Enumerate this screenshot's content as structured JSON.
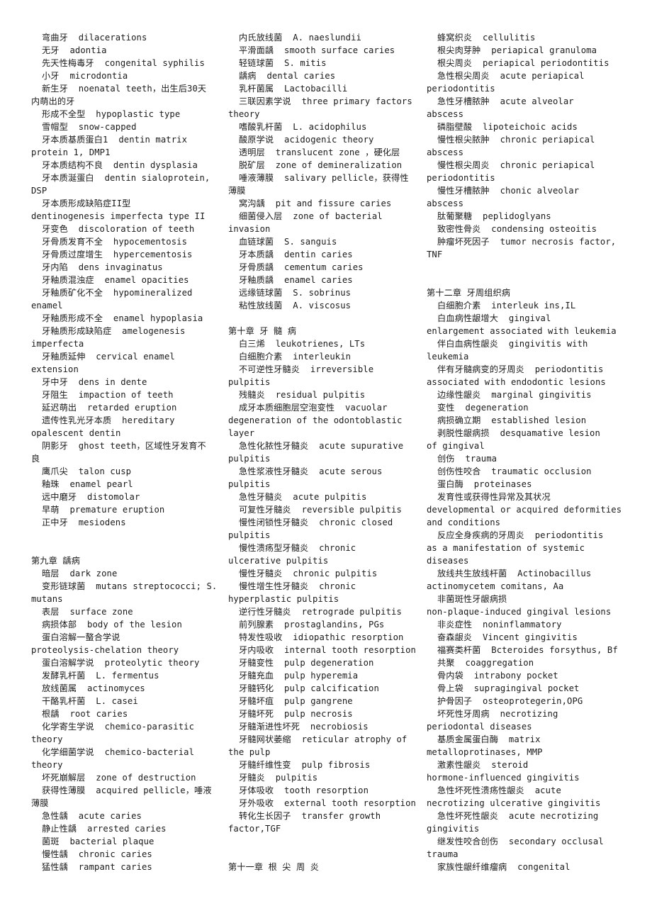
{
  "columns": [
    {
      "lines": [
        {
          "t": "entry",
          "v": "弯曲牙  dilacerations"
        },
        {
          "t": "entry",
          "v": "无牙  adontia"
        },
        {
          "t": "entry",
          "v": "先天性梅毒牙  congenital syphilis"
        },
        {
          "t": "entry",
          "v": "小牙  microdontia"
        },
        {
          "t": "entry",
          "v": "新生牙  noenatal teeth，出生后30天"
        },
        {
          "t": "cont",
          "v": "内萌出的牙"
        },
        {
          "t": "entry",
          "v": "形成不全型  hypoplastic type"
        },
        {
          "t": "entry",
          "v": "雪帽型  snow-capped"
        },
        {
          "t": "entry",
          "v": "牙本质基质蛋白1  dentin matrix"
        },
        {
          "t": "cont",
          "v": "protein 1, DMP1"
        },
        {
          "t": "entry",
          "v": "牙本质结构不良  dentin dysplasia"
        },
        {
          "t": "entry",
          "v": "牙本质涎蛋白  dentin sialoprotein,"
        },
        {
          "t": "cont",
          "v": "DSP"
        },
        {
          "t": "entry",
          "v": "牙本质形成缺陷症II型"
        },
        {
          "t": "cont",
          "v": "dentinogenesis imperfecta type II"
        },
        {
          "t": "entry",
          "v": "牙变色  discoloration of teeth"
        },
        {
          "t": "entry",
          "v": "牙骨质发育不全  hypocementosis"
        },
        {
          "t": "entry",
          "v": "牙骨质过度增生  hypercementosis"
        },
        {
          "t": "entry",
          "v": "牙内陷  dens invaginatus"
        },
        {
          "t": "entry",
          "v": "牙釉质混浊症  enamel opacities"
        },
        {
          "t": "entry",
          "v": "牙釉质矿化不全  hypomineralized"
        },
        {
          "t": "cont",
          "v": "enamel"
        },
        {
          "t": "entry",
          "v": "牙釉质形成不全  enamel hypoplasia"
        },
        {
          "t": "entry",
          "v": "牙釉质形成缺陷症  amelogenesis"
        },
        {
          "t": "cont",
          "v": "imperfecta"
        },
        {
          "t": "entry",
          "v": "牙釉质延伸  cervical enamel"
        },
        {
          "t": "cont",
          "v": "extension"
        },
        {
          "t": "entry",
          "v": "牙中牙  dens in dente"
        },
        {
          "t": "entry",
          "v": "牙阻生  impaction of teeth"
        },
        {
          "t": "entry",
          "v": "延迟萌出  retarded eruption"
        },
        {
          "t": "entry",
          "v": "遗传性乳光牙本质  hereditary"
        },
        {
          "t": "cont",
          "v": "opalescent dentin"
        },
        {
          "t": "entry",
          "v": "阴影牙  ghost teeth，区域性牙发育不"
        },
        {
          "t": "cont",
          "v": "良"
        },
        {
          "t": "entry",
          "v": "鹰爪尖  talon cusp"
        },
        {
          "t": "entry",
          "v": "釉珠  enamel pearl"
        },
        {
          "t": "entry",
          "v": "远中磨牙  distomolar"
        },
        {
          "t": "entry",
          "v": "早萌  premature eruption"
        },
        {
          "t": "entry",
          "v": "正中牙  mesiodens"
        },
        {
          "t": "blank",
          "v": ""
        },
        {
          "t": "blank",
          "v": ""
        },
        {
          "t": "heading",
          "v": "第九章 龋病"
        },
        {
          "t": "entry",
          "v": "暗层  dark zone"
        },
        {
          "t": "entry",
          "v": "变形链球菌  mutans streptococci; S."
        },
        {
          "t": "cont",
          "v": "mutans"
        },
        {
          "t": "entry",
          "v": "表层  surface zone"
        },
        {
          "t": "entry",
          "v": "病损体部  body of the lesion"
        },
        {
          "t": "entry",
          "v": "蛋白溶解一螯合学说"
        },
        {
          "t": "cont",
          "v": "proteolysis-chelation theory"
        },
        {
          "t": "entry",
          "v": "蛋白溶解学说  proteolytic theory"
        },
        {
          "t": "entry",
          "v": "发酵乳杆菌  L. fermentus"
        },
        {
          "t": "entry",
          "v": "放线菌属  actinomyces"
        },
        {
          "t": "entry",
          "v": "干酪乳杆菌  L. casei"
        },
        {
          "t": "entry",
          "v": "根龋  root caries"
        },
        {
          "t": "entry",
          "v": "化学寄生学说  chemico-parasitic"
        },
        {
          "t": "cont",
          "v": "theory"
        },
        {
          "t": "entry",
          "v": "化学细菌学说  chemico-bacterial"
        },
        {
          "t": "cont",
          "v": "theory"
        },
        {
          "t": "entry",
          "v": "坏死崩解层  zone of destruction"
        },
        {
          "t": "entry",
          "v": "获得性薄膜  acquired pellicle，唾液"
        },
        {
          "t": "cont",
          "v": "薄膜"
        },
        {
          "t": "entry",
          "v": "急性龋  acute caries"
        },
        {
          "t": "entry",
          "v": "静止性龋  arrested caries"
        },
        {
          "t": "entry",
          "v": "菌斑  bacterial plaque"
        },
        {
          "t": "entry",
          "v": "慢性龋  chronic caries"
        },
        {
          "t": "entry",
          "v": "猛性龋  rampant caries"
        }
      ]
    },
    {
      "lines": [
        {
          "t": "entry",
          "v": "内氏放线菌  A. naeslundii"
        },
        {
          "t": "entry",
          "v": "平滑面龋  smooth surface caries"
        },
        {
          "t": "entry",
          "v": "轻链球菌  S. mitis"
        },
        {
          "t": "entry",
          "v": "龋病  dental caries"
        },
        {
          "t": "entry",
          "v": "乳杆菌属  Lactobacilli"
        },
        {
          "t": "entry",
          "v": "三联因素学说  three primary factors"
        },
        {
          "t": "cont",
          "v": "theory"
        },
        {
          "t": "entry",
          "v": "嗜酸乳杆菌  L. acidophilus"
        },
        {
          "t": "entry",
          "v": "酸原学说  acidogenic theory"
        },
        {
          "t": "entry",
          "v": "透明层  translucent zone ，硬化层"
        },
        {
          "t": "entry",
          "v": "脱矿层  zone of demineralization"
        },
        {
          "t": "entry",
          "v": "唾液薄膜  salivary pellicle，获得性"
        },
        {
          "t": "cont",
          "v": "薄膜"
        },
        {
          "t": "entry",
          "v": "窝沟龋  pit and fissure caries"
        },
        {
          "t": "entry",
          "v": "细菌侵入层  zone of bacterial"
        },
        {
          "t": "cont",
          "v": "invasion"
        },
        {
          "t": "entry",
          "v": "血链球菌  S. sanguis"
        },
        {
          "t": "entry",
          "v": "牙本质龋  dentin caries"
        },
        {
          "t": "entry",
          "v": "牙骨质龋  cementum caries"
        },
        {
          "t": "entry",
          "v": "牙釉质龋  enamel caries"
        },
        {
          "t": "entry",
          "v": "远缘链球菌  S. sobrinus"
        },
        {
          "t": "entry",
          "v": "粘性放线菌  A. viscosus"
        },
        {
          "t": "blank",
          "v": ""
        },
        {
          "t": "heading",
          "v": "第十章 牙 髓 病"
        },
        {
          "t": "entry",
          "v": "白三烯  leukotrienes, LTs"
        },
        {
          "t": "entry",
          "v": "白细胞介素  interleukin"
        },
        {
          "t": "entry",
          "v": "不可逆性牙髓炎  irreversible"
        },
        {
          "t": "cont",
          "v": "pulpitis"
        },
        {
          "t": "entry",
          "v": "残髓炎  residual pulpitis"
        },
        {
          "t": "entry",
          "v": "成牙本质细胞层空泡变性  vacuolar"
        },
        {
          "t": "cont",
          "v": "degeneration of the odontoblastic"
        },
        {
          "t": "cont",
          "v": "layer"
        },
        {
          "t": "entry",
          "v": "急性化脓性牙髓炎  acute supurative"
        },
        {
          "t": "cont",
          "v": "pulpitis"
        },
        {
          "t": "entry",
          "v": "急性浆液性牙髓炎  acute serous"
        },
        {
          "t": "cont",
          "v": "pulpitis"
        },
        {
          "t": "entry",
          "v": "急性牙髓炎  acute pulpitis"
        },
        {
          "t": "entry",
          "v": "可复性牙髓炎  reversible pulpitis"
        },
        {
          "t": "entry",
          "v": "慢性闭锁性牙髓炎  chronic closed"
        },
        {
          "t": "cont",
          "v": "pulpitis"
        },
        {
          "t": "entry",
          "v": "慢性溃疡型牙髓炎  chronic"
        },
        {
          "t": "cont",
          "v": "ulcerative pulpitis"
        },
        {
          "t": "entry",
          "v": "慢性牙髓炎  chronic pulpitis"
        },
        {
          "t": "entry",
          "v": "慢性增生性牙髓炎  chronic"
        },
        {
          "t": "cont",
          "v": "hyperplastic pulpitis"
        },
        {
          "t": "entry",
          "v": "逆行性牙髓炎  retrograde pulpitis"
        },
        {
          "t": "entry",
          "v": "前列腺素  prostaglandins, PGs"
        },
        {
          "t": "entry",
          "v": "特发性吸收  idiopathic resorption"
        },
        {
          "t": "entry",
          "v": "牙内吸收  internal tooth resorption"
        },
        {
          "t": "entry",
          "v": "牙髓变性  pulp degeneration"
        },
        {
          "t": "entry",
          "v": "牙髓充血  pulp hyperemia"
        },
        {
          "t": "entry",
          "v": "牙髓钙化  pulp calcification"
        },
        {
          "t": "entry",
          "v": "牙髓坏疽  pulp gangrene"
        },
        {
          "t": "entry",
          "v": "牙髓坏死  pulp necrosis"
        },
        {
          "t": "entry",
          "v": "牙髓渐进性坏死  necrobiosis"
        },
        {
          "t": "entry",
          "v": "牙髓网状萎缩  reticular atrophy of"
        },
        {
          "t": "cont",
          "v": "the pulp"
        },
        {
          "t": "entry",
          "v": "牙髓纤维性变  pulp fibrosis"
        },
        {
          "t": "entry",
          "v": "牙髓炎  pulpitis"
        },
        {
          "t": "entry",
          "v": "牙体吸收  tooth resorption"
        },
        {
          "t": "entry",
          "v": "牙外吸收  external tooth resorption"
        },
        {
          "t": "entry",
          "v": "转化生长因子  transfer growth"
        },
        {
          "t": "cont",
          "v": "factor,TGF"
        },
        {
          "t": "blank",
          "v": ""
        },
        {
          "t": "blank",
          "v": ""
        },
        {
          "t": "heading",
          "v": "第十一章 根 尖 周 炎"
        }
      ]
    },
    {
      "lines": [
        {
          "t": "entry",
          "v": "蜂窝织炎  cellulitis"
        },
        {
          "t": "entry",
          "v": "根尖肉芽肿  periapical granuloma"
        },
        {
          "t": "entry",
          "v": "根尖周炎  periapical periodontitis"
        },
        {
          "t": "entry",
          "v": "急性根尖周炎  acute periapical"
        },
        {
          "t": "cont",
          "v": "periodontitis"
        },
        {
          "t": "entry",
          "v": "急性牙槽脓肿  acute alveolar"
        },
        {
          "t": "cont",
          "v": "abscess"
        },
        {
          "t": "entry",
          "v": "磷脂壁酸  lipoteichoic acids"
        },
        {
          "t": "entry",
          "v": "慢性根尖脓肿  chronic periapical"
        },
        {
          "t": "cont",
          "v": "abscess"
        },
        {
          "t": "entry",
          "v": "慢性根尖周炎  chronic periapical"
        },
        {
          "t": "cont",
          "v": "periodontitis"
        },
        {
          "t": "entry",
          "v": "慢性牙槽脓肿  chonic alveolar"
        },
        {
          "t": "cont",
          "v": "abscess"
        },
        {
          "t": "entry",
          "v": "肽葡聚糖  peplidoglyans"
        },
        {
          "t": "entry",
          "v": "致密性骨炎  condensing osteoitis"
        },
        {
          "t": "entry",
          "v": "肿瘤坏死因子  tumor necrosis factor,"
        },
        {
          "t": "cont",
          "v": "TNF"
        },
        {
          "t": "blank",
          "v": ""
        },
        {
          "t": "blank",
          "v": ""
        },
        {
          "t": "heading",
          "v": "第十二章 牙周组织病"
        },
        {
          "t": "entry",
          "v": "白细胞介素  interleuk ins,IL"
        },
        {
          "t": "entry",
          "v": "白血病性龈增大  gingival"
        },
        {
          "t": "cont",
          "v": "enlargement associated with leukemia"
        },
        {
          "t": "entry",
          "v": "伴白血病性龈炎  gingivitis with"
        },
        {
          "t": "cont",
          "v": "leukemia"
        },
        {
          "t": "entry",
          "v": "伴有牙髓病变的牙周炎  periodontitis"
        },
        {
          "t": "cont",
          "v": "associated with endodontic lesions"
        },
        {
          "t": "entry",
          "v": "边缘性龈炎  marginal gingivitis"
        },
        {
          "t": "entry",
          "v": "变性  degeneration"
        },
        {
          "t": "entry",
          "v": "病损确立期  established lesion"
        },
        {
          "t": "entry",
          "v": "剥脱性龈病损  desquamative lesion"
        },
        {
          "t": "cont",
          "v": "of gingival"
        },
        {
          "t": "entry",
          "v": "创伤  trauma"
        },
        {
          "t": "entry",
          "v": "创伤性咬合  traumatic occlusion"
        },
        {
          "t": "entry",
          "v": "蛋白酶  proteinases"
        },
        {
          "t": "entry",
          "v": "发育性或获得性异常及其状况"
        },
        {
          "t": "cont",
          "v": "developmental or acquired deformities"
        },
        {
          "t": "cont",
          "v": "and conditions"
        },
        {
          "t": "entry",
          "v": "反应全身疾病的牙周炎  periodontitis"
        },
        {
          "t": "cont",
          "v": "as a manifestation of systemic"
        },
        {
          "t": "cont",
          "v": "diseases"
        },
        {
          "t": "entry",
          "v": "放线共生放线杆菌  Actinobacillus"
        },
        {
          "t": "cont",
          "v": "actinomycetem comitans, Aa"
        },
        {
          "t": "entry",
          "v": "非菌斑性牙龈病损"
        },
        {
          "t": "cont",
          "v": "non-plaque-induced gingival lesions"
        },
        {
          "t": "entry",
          "v": "非炎症性  noninflammatory"
        },
        {
          "t": "entry",
          "v": "奋森龈炎  Vincent gingivitis"
        },
        {
          "t": "entry",
          "v": "福赛类杆菌  Bcteroides forsythus, Bf"
        },
        {
          "t": "entry",
          "v": "共聚  coaggregation"
        },
        {
          "t": "entry",
          "v": "骨内袋  intrabony pocket"
        },
        {
          "t": "entry",
          "v": "骨上袋  supragingival pocket"
        },
        {
          "t": "entry",
          "v": "护骨因子  osteoprotegerin,OPG"
        },
        {
          "t": "entry",
          "v": "坏死性牙周病  necrotizing"
        },
        {
          "t": "cont",
          "v": "periodontal diseases"
        },
        {
          "t": "entry",
          "v": "基质金属蛋白酶  matrix"
        },
        {
          "t": "cont",
          "v": "metalloprotinases, MMP"
        },
        {
          "t": "entry",
          "v": "激素性龈炎  steroid"
        },
        {
          "t": "cont",
          "v": "hormone-influenced gingivitis"
        },
        {
          "t": "entry",
          "v": "急性坏死性溃疡性龈炎  acute"
        },
        {
          "t": "cont",
          "v": "necrotizing ulcerative gingivitis"
        },
        {
          "t": "entry",
          "v": "急性坏死性龈炎  acute necrotizing"
        },
        {
          "t": "cont",
          "v": "gingivitis"
        },
        {
          "t": "entry",
          "v": "继发性咬合创伤  secondary occlusal"
        },
        {
          "t": "cont",
          "v": "trauma"
        },
        {
          "t": "entry",
          "v": "家族性龈纤维瘤病  congenital"
        }
      ]
    }
  ]
}
